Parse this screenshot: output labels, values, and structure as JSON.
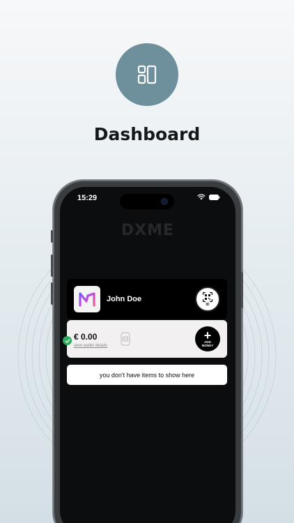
{
  "header": {
    "icon": "dashboard-layout-icon",
    "title": "Dashboard"
  },
  "phone": {
    "status_bar": {
      "time": "15:29",
      "icons": [
        "wifi-icon",
        "battery-icon"
      ]
    },
    "brand": "DXME",
    "user_card": {
      "logo": "app-logo-icon",
      "name": "John Doe",
      "id_button_label": "ID"
    },
    "wallet_card": {
      "balance": "€ 0.00",
      "link_text": "view wallet details",
      "add_button": {
        "plus": "+",
        "label": "ADD MONEY"
      }
    },
    "empty_message": "you don't have items to show here"
  },
  "colors": {
    "hero_circle": "#6e8f9c",
    "screen_bg": "#0c0d0e",
    "verified": "#2daa5c"
  }
}
